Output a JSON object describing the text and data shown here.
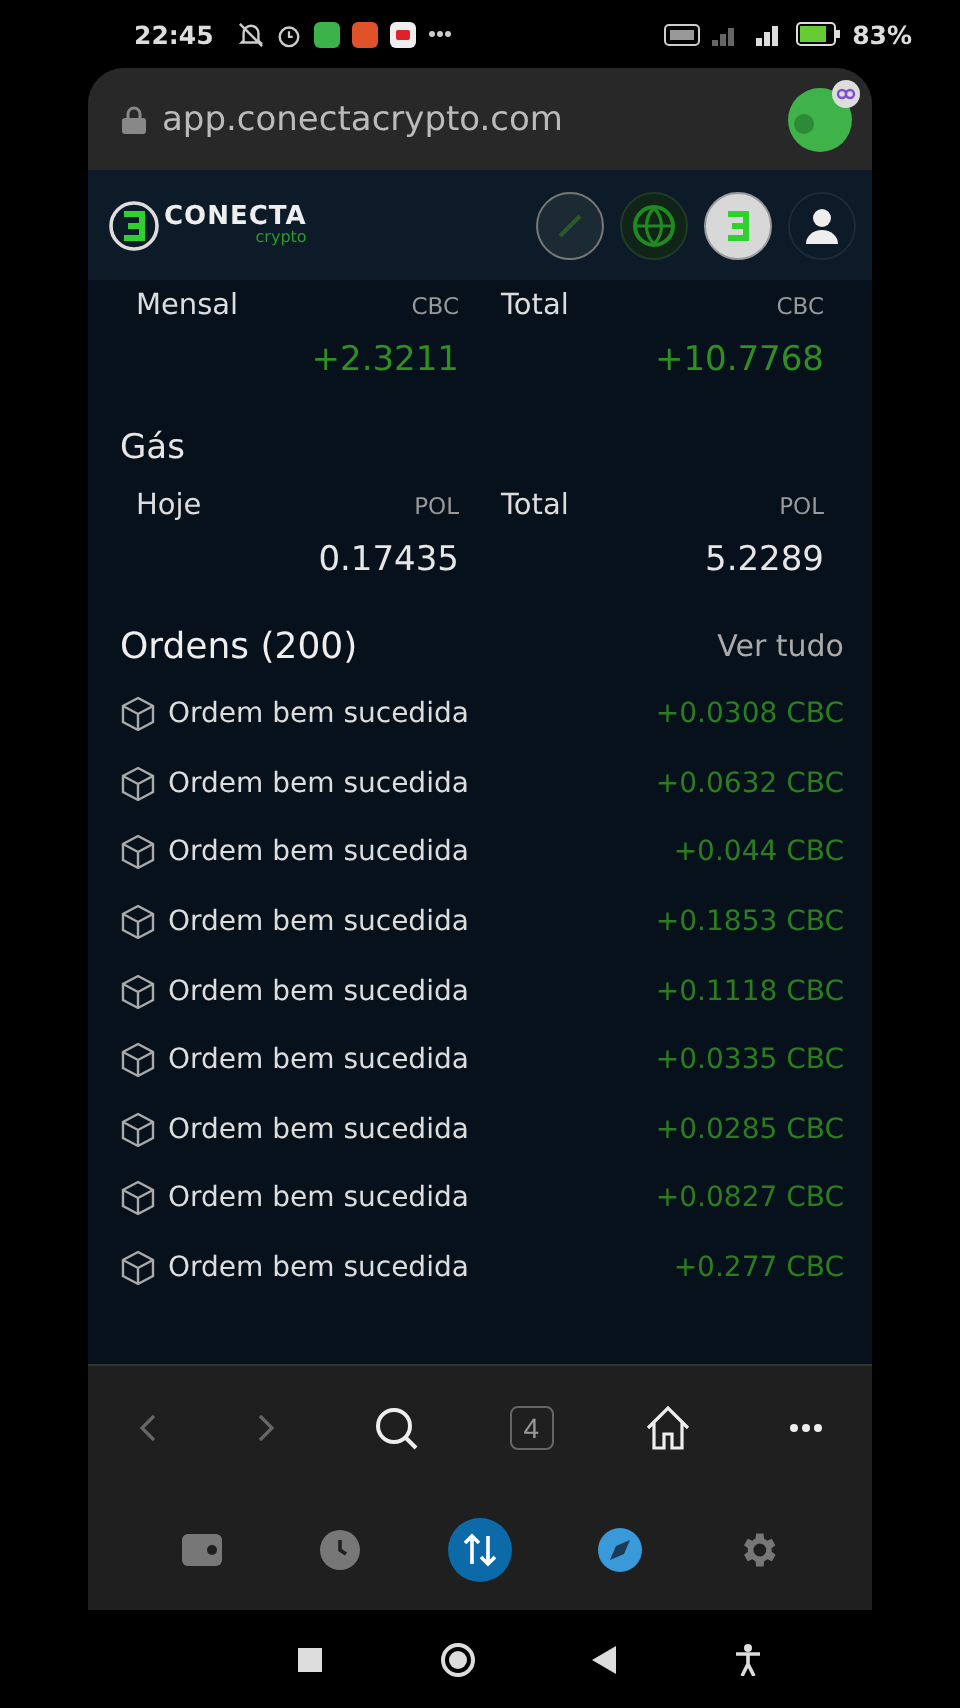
{
  "status_bar": {
    "time": "22:45",
    "battery": "83%"
  },
  "browser": {
    "url": "app.conectacrypto.com",
    "tab_count": "4"
  },
  "header": {
    "logo_text": "CONECTA",
    "logo_subtext": "crypto"
  },
  "earnings": [
    {
      "label": "Mensal",
      "unit": "CBC",
      "value": "+2.3211",
      "positive": true
    },
    {
      "label": "Total",
      "unit": "CBC",
      "value": "+10.7768",
      "positive": true
    }
  ],
  "gas": {
    "title": "Gás",
    "items": [
      {
        "label": "Hoje",
        "unit": "POL",
        "value": "0.17435",
        "positive": false
      },
      {
        "label": "Total",
        "unit": "POL",
        "value": "5.2289",
        "positive": false
      }
    ]
  },
  "orders": {
    "title": "Ordens (200)",
    "link": "Ver tudo",
    "items": [
      {
        "label": "Ordem bem sucedida",
        "amount": "+0.0308 CBC"
      },
      {
        "label": "Ordem bem sucedida",
        "amount": "+0.0632 CBC"
      },
      {
        "label": "Ordem bem sucedida",
        "amount": "+0.044 CBC"
      },
      {
        "label": "Ordem bem sucedida",
        "amount": "+0.1853 CBC"
      },
      {
        "label": "Ordem bem sucedida",
        "amount": "+0.1118 CBC"
      },
      {
        "label": "Ordem bem sucedida",
        "amount": "+0.0335 CBC"
      },
      {
        "label": "Ordem bem sucedida",
        "amount": "+0.0285 CBC"
      },
      {
        "label": "Ordem bem sucedida",
        "amount": "+0.0827 CBC"
      },
      {
        "label": "Ordem bem sucedida",
        "amount": "+0.277 CBC"
      }
    ]
  },
  "app_tabs": [
    {
      "kind": "wallet",
      "selected": false
    },
    {
      "kind": "history",
      "selected": false
    },
    {
      "kind": "transfer",
      "selected": true
    },
    {
      "kind": "explore",
      "selected": false
    },
    {
      "kind": "settings",
      "selected": false
    }
  ]
}
